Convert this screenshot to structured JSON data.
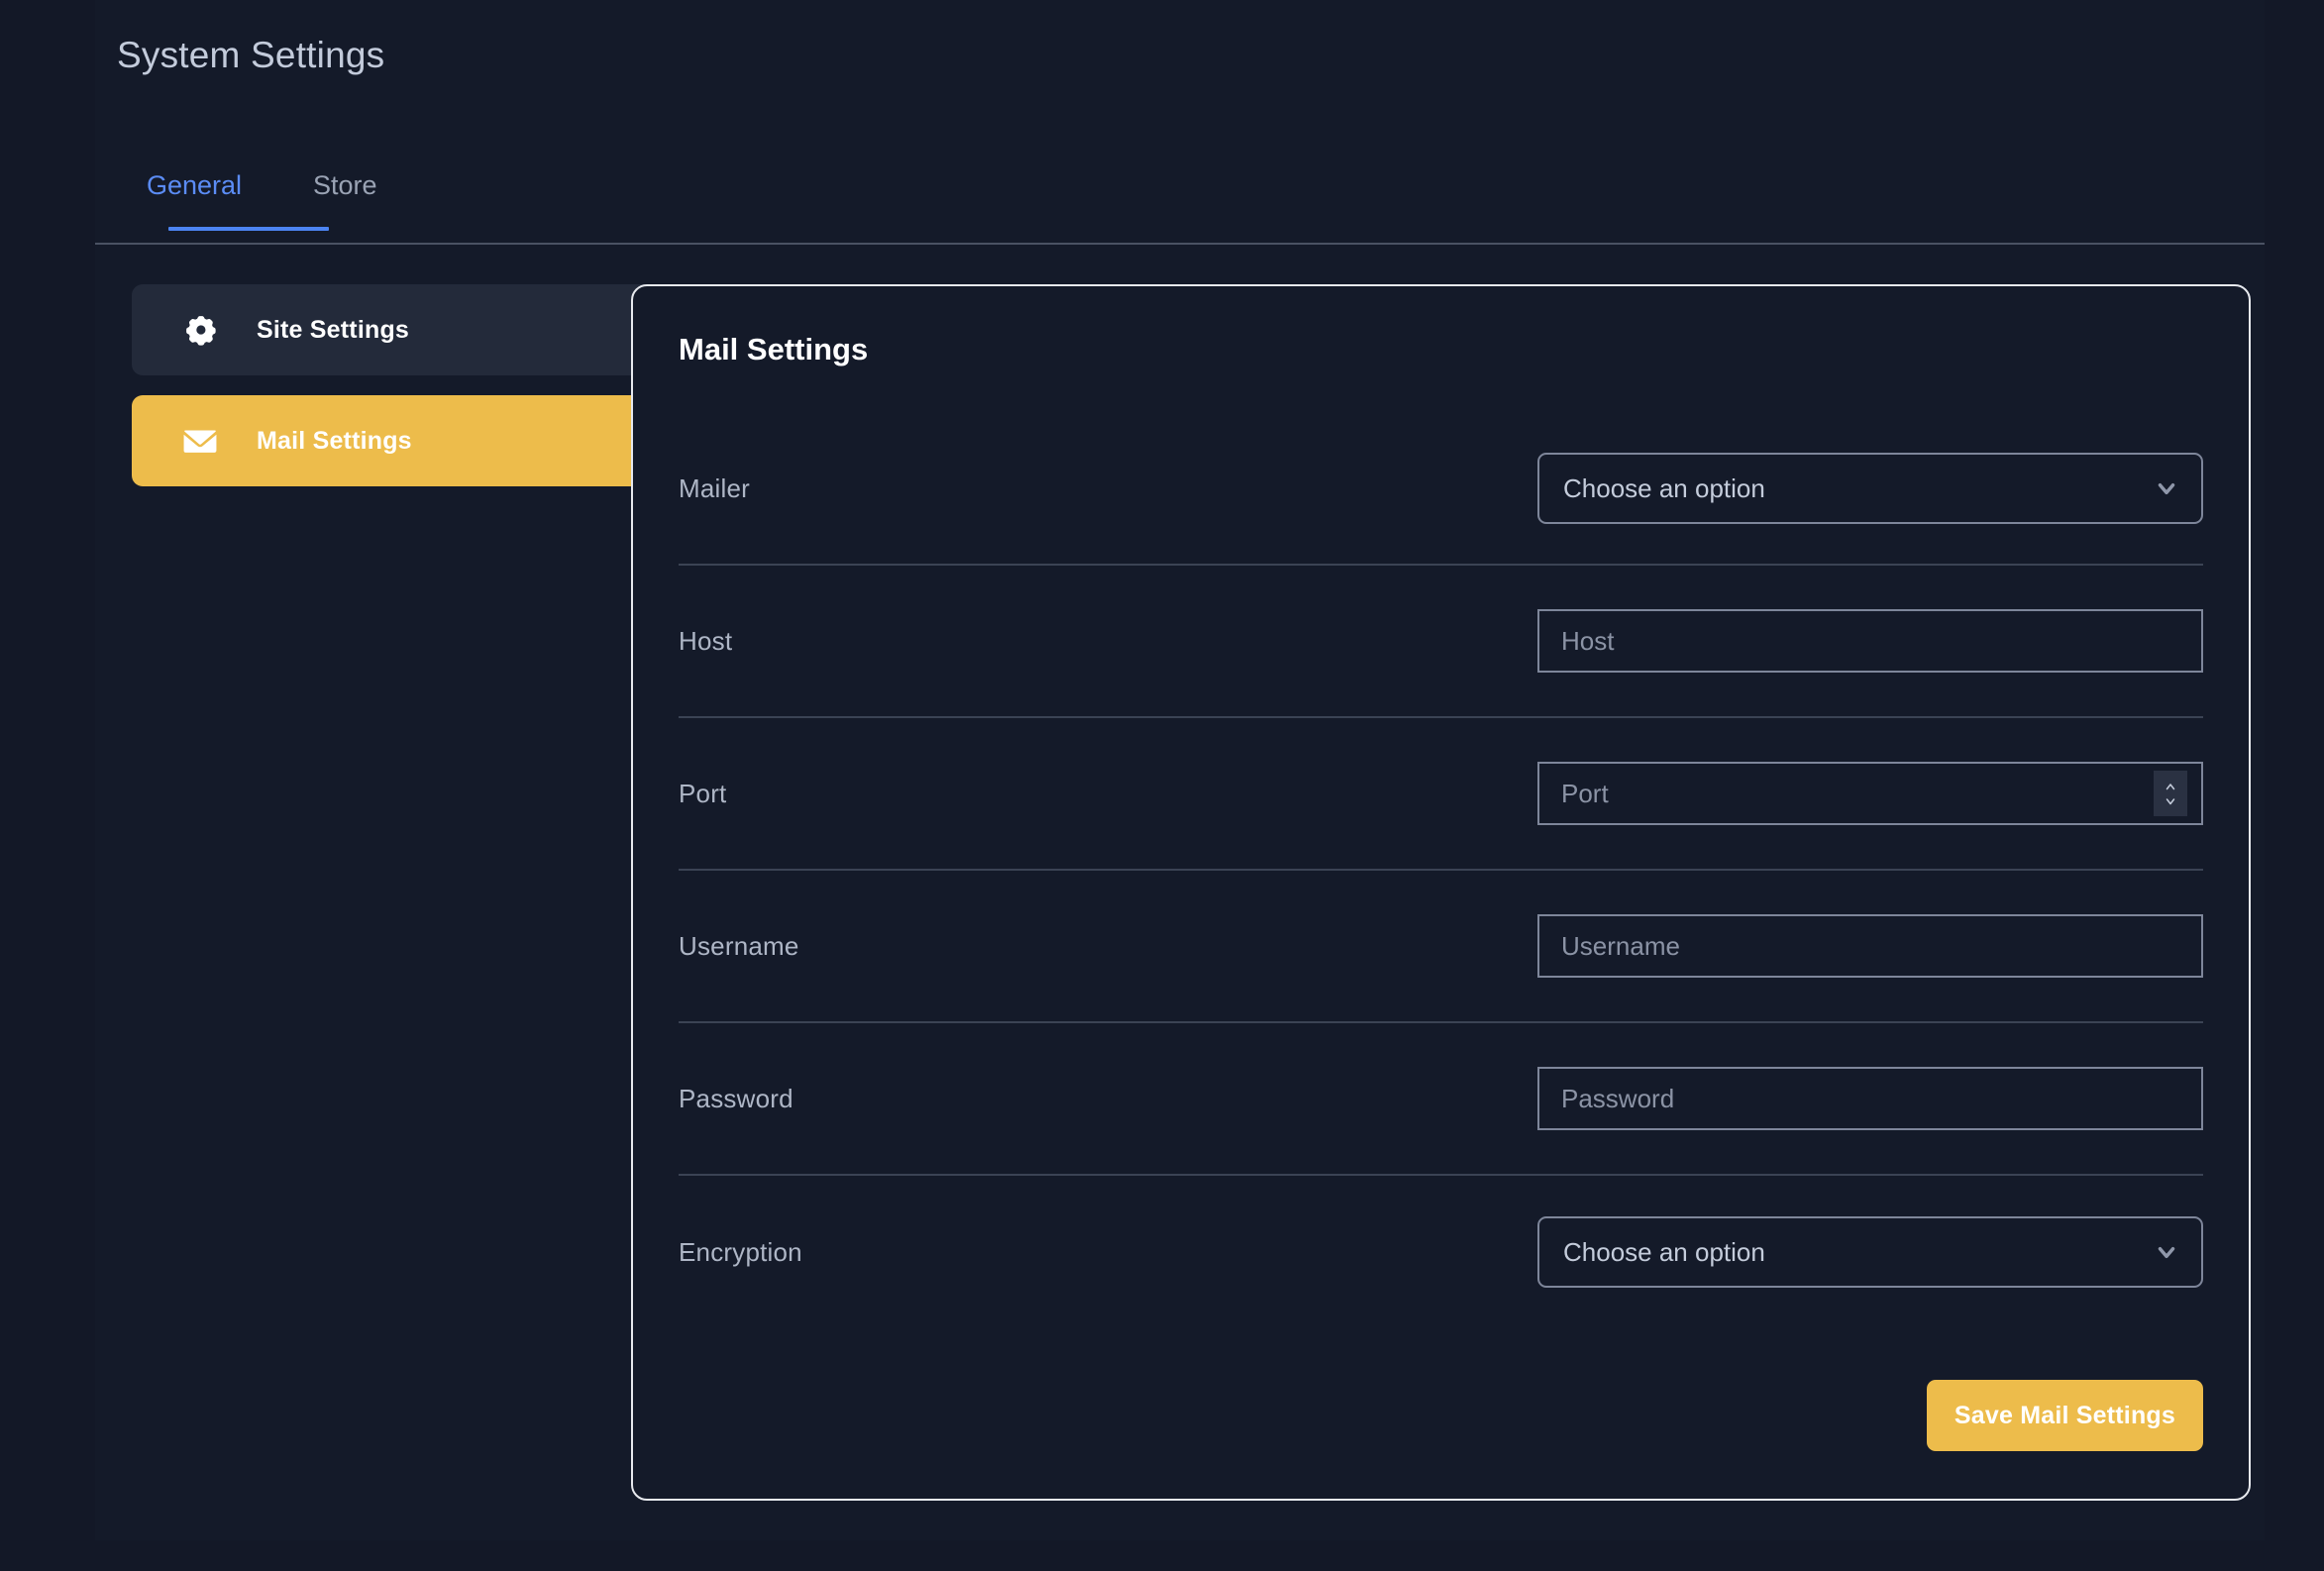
{
  "header": {
    "title": "System Settings"
  },
  "tabs": [
    {
      "label": "General",
      "active": true
    },
    {
      "label": "Store",
      "active": false
    }
  ],
  "sidebar": {
    "items": [
      {
        "label": "Site Settings",
        "icon": "gear-icon",
        "active": false
      },
      {
        "label": "Mail Settings",
        "icon": "envelope-icon",
        "active": true
      }
    ]
  },
  "card": {
    "title": "Mail Settings",
    "rows": [
      {
        "label": "Mailer",
        "control": "select",
        "value": "Choose an option"
      },
      {
        "label": "Host",
        "control": "text",
        "placeholder": "Host"
      },
      {
        "label": "Port",
        "control": "number",
        "placeholder": "Port"
      },
      {
        "label": "Username",
        "control": "text",
        "placeholder": "Username"
      },
      {
        "label": "Password",
        "control": "text",
        "placeholder": "Password"
      },
      {
        "label": "Encryption",
        "control": "select",
        "value": "Choose an option"
      }
    ],
    "save_label": "Save Mail Settings"
  },
  "colors": {
    "page_bg": "#131827",
    "panel_bg": "#141a29",
    "accent_amber": "#edbc4b",
    "accent_blue": "#4c84f2",
    "sidebar_item_bg": "#232a3a",
    "card_border": "#e7e9ee"
  }
}
